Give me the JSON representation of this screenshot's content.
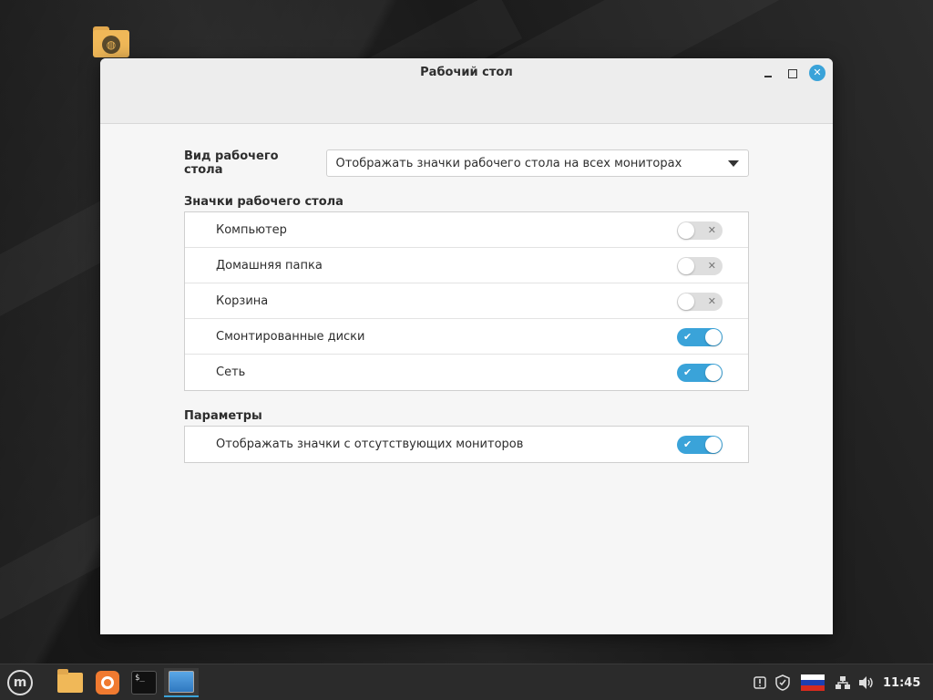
{
  "window": {
    "title": "Рабочий стол"
  },
  "desktop_view": {
    "label": "Вид рабочего стола",
    "selected": "Отображать значки рабочего стола на всех мониторах"
  },
  "desktop_icons": {
    "heading": "Значки рабочего стола",
    "items": [
      {
        "label": "Компьютер",
        "enabled": false
      },
      {
        "label": "Домашняя папка",
        "enabled": false
      },
      {
        "label": "Корзина",
        "enabled": false
      },
      {
        "label": "Смонтированные диски",
        "enabled": true
      },
      {
        "label": "Сеть",
        "enabled": true
      }
    ]
  },
  "options": {
    "heading": "Параметры",
    "items": [
      {
        "label": "Отображать значки с отсутствующих мониторов",
        "enabled": true
      }
    ]
  },
  "taskbar": {
    "clock": "11:45",
    "accent": "#3aa3d9"
  },
  "icons": {
    "check": "✔",
    "cross": "✕",
    "close": "✕"
  }
}
